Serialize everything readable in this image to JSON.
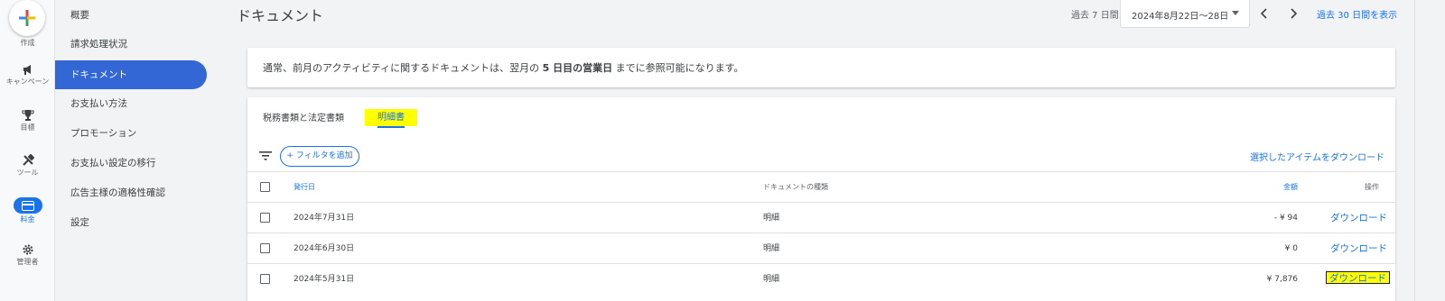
{
  "rail": {
    "create_label": "作成",
    "items": [
      {
        "label": "キャンペーン",
        "icon": "megaphone-icon"
      },
      {
        "label": "目標",
        "icon": "trophy-icon"
      },
      {
        "label": "ツール",
        "icon": "tools-icon"
      },
      {
        "label": "料金",
        "icon": "credit-card-icon"
      },
      {
        "label": "管理者",
        "icon": "gear-icon"
      }
    ]
  },
  "subnav": {
    "items": [
      {
        "label": "概要"
      },
      {
        "label": "請求処理状況"
      },
      {
        "label": "ドキュメント"
      },
      {
        "label": "お支払い方法"
      },
      {
        "label": "プロモーション"
      },
      {
        "label": "お支払い設定の移行"
      },
      {
        "label": "広告主様の適格性確認"
      },
      {
        "label": "設定"
      }
    ],
    "active_index": 2
  },
  "header": {
    "title": "ドキュメント",
    "range_label": "過去 7 日間",
    "date_range": "2024年8月22日〜28日",
    "show_30_link": "過去 30 日間を表示"
  },
  "notice": {
    "before": "通常、前月のアクティビティに関するドキュメントは、翌月の ",
    "bold": "5 日目の営業日",
    "after": " までに参照可能になります。"
  },
  "tabs": {
    "tab1": "税務書類と法定書類",
    "tab2": "明細書"
  },
  "toolbar": {
    "filter_button": "+ フィルタを追加",
    "download_selected": "選択したアイテムをダウンロード"
  },
  "table": {
    "headers": {
      "date": "発行日",
      "type": "ドキュメントの種類",
      "amount": "金額",
      "action": "操作"
    },
    "rows": [
      {
        "date": "2024年7月31日",
        "type": "明細",
        "amount": "- ¥ 94",
        "action": "ダウンロード"
      },
      {
        "date": "2024年6月30日",
        "type": "明細",
        "amount": "¥ 0",
        "action": "ダウンロード"
      },
      {
        "date": "2024年5月31日",
        "type": "明細",
        "amount": "¥ 7,876",
        "action": "ダウンロード"
      }
    ]
  },
  "colors": {
    "accent": "#1a73e8",
    "active_nav": "#3367d6",
    "highlight": "#ffff00"
  }
}
